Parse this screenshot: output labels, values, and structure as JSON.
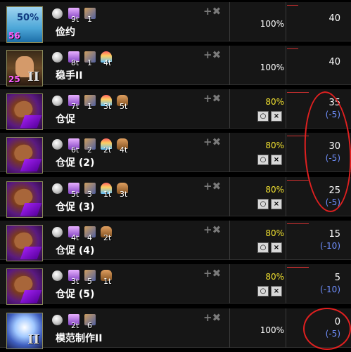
{
  "rows": [
    {
      "name": "俭约",
      "icon": "thrift",
      "icon_text": "50%",
      "badge": "56",
      "roman": "",
      "conditions": [
        {
          "icon": "orb-icon",
          "label": ""
        },
        {
          "icon": "star-icon",
          "label": "9t"
        },
        {
          "icon": "cube-icon",
          "label": "1"
        }
      ],
      "probability": "100%",
      "probability_style": "full",
      "value": "40",
      "delta": "",
      "progress": 0.18,
      "toggles": false
    },
    {
      "name": "稳手II",
      "icon": "steady",
      "icon_text": "",
      "badge": "25",
      "roman": "II",
      "conditions": [
        {
          "icon": "orb-icon",
          "label": ""
        },
        {
          "icon": "star-icon",
          "label": "8t"
        },
        {
          "icon": "cube-icon",
          "label": "1"
        },
        {
          "icon": "rainbow-icon",
          "label": "4t"
        }
      ],
      "probability": "100%",
      "probability_style": "full",
      "value": "40",
      "delta": "",
      "progress": 0.18,
      "toggles": false
    },
    {
      "name": "仓促",
      "icon": "hand",
      "icon_text": "",
      "badge": "",
      "roman": "",
      "conditions": [
        {
          "icon": "orb-icon",
          "label": ""
        },
        {
          "icon": "star-icon",
          "label": "7t"
        },
        {
          "icon": "cube-icon",
          "label": "1"
        },
        {
          "icon": "rainbow-icon",
          "label": "3t"
        },
        {
          "icon": "palm-icon",
          "label": "5t"
        }
      ],
      "probability": "80%",
      "probability_style": "partial",
      "value": "35",
      "delta": "(-5)",
      "progress": 0.35,
      "toggles": true
    },
    {
      "name": "仓促 (2)",
      "icon": "hand",
      "icon_text": "",
      "badge": "",
      "roman": "",
      "conditions": [
        {
          "icon": "orb-icon",
          "label": ""
        },
        {
          "icon": "star-icon",
          "label": "6t"
        },
        {
          "icon": "cube-icon",
          "label": "2"
        },
        {
          "icon": "rainbow-icon",
          "label": "2t"
        },
        {
          "icon": "palm-icon",
          "label": "4t"
        }
      ],
      "probability": "80%",
      "probability_style": "partial",
      "value": "30",
      "delta": "(-5)",
      "progress": 0.35,
      "toggles": true
    },
    {
      "name": "仓促 (3)",
      "icon": "hand",
      "icon_text": "",
      "badge": "",
      "roman": "",
      "conditions": [
        {
          "icon": "orb-icon",
          "label": ""
        },
        {
          "icon": "star-icon",
          "label": "5t"
        },
        {
          "icon": "cube-icon",
          "label": "3"
        },
        {
          "icon": "rainbow-icon",
          "label": "1t"
        },
        {
          "icon": "palm-icon",
          "label": "3t"
        }
      ],
      "probability": "80%",
      "probability_style": "partial",
      "value": "25",
      "delta": "(-5)",
      "progress": 0.35,
      "toggles": true
    },
    {
      "name": "仓促 (4)",
      "icon": "hand",
      "icon_text": "",
      "badge": "",
      "roman": "",
      "conditions": [
        {
          "icon": "orb-icon",
          "label": ""
        },
        {
          "icon": "star-icon",
          "label": "4t"
        },
        {
          "icon": "cube-icon",
          "label": "4"
        },
        {
          "icon": "palm-icon",
          "label": "2t"
        }
      ],
      "probability": "80%",
      "probability_style": "partial",
      "value": "15",
      "delta": "(-10)",
      "progress": 0.35,
      "toggles": true
    },
    {
      "name": "仓促 (5)",
      "icon": "hand",
      "icon_text": "",
      "badge": "",
      "roman": "",
      "conditions": [
        {
          "icon": "orb-icon",
          "label": ""
        },
        {
          "icon": "star-icon",
          "label": "3t"
        },
        {
          "icon": "cube-icon",
          "label": "5"
        },
        {
          "icon": "palm-icon",
          "label": "1t"
        }
      ],
      "probability": "80%",
      "probability_style": "partial",
      "value": "5",
      "delta": "(-10)",
      "progress": 0.35,
      "toggles": true
    },
    {
      "name": "模范制作II",
      "icon": "model",
      "icon_text": "",
      "badge": "",
      "roman": "II",
      "conditions": [
        {
          "icon": "orb-icon",
          "label": ""
        },
        {
          "icon": "star-icon",
          "label": "2t"
        },
        {
          "icon": "cube-icon",
          "label": "6"
        }
      ],
      "probability": "100%",
      "probability_style": "full",
      "value": "0",
      "delta": "(-5)",
      "progress": 0.0,
      "toggles": false
    }
  ],
  "row_controls": {
    "add_remove": "+✖",
    "toggle_on": "○",
    "toggle_off": "×"
  },
  "colors": {
    "probability_partial": "#f0e030",
    "delta": "#7090ff",
    "annotation_circle": "#e02020",
    "progress": "#d03030"
  }
}
